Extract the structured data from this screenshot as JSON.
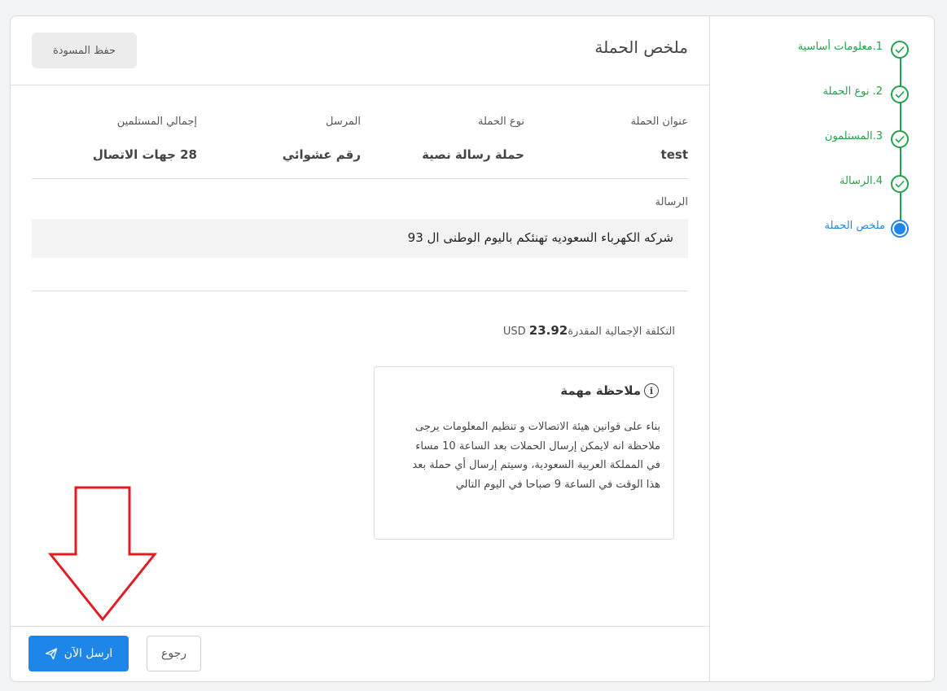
{
  "stepper": {
    "steps": [
      {
        "label": "1.معلومات أساسية",
        "state": "done"
      },
      {
        "label": "2. نوع الحملة",
        "state": "done"
      },
      {
        "label": "3.المستلمون",
        "state": "done"
      },
      {
        "label": "4.الرسالة",
        "state": "done"
      },
      {
        "label": "ملخص الحملة",
        "state": "active"
      }
    ]
  },
  "header": {
    "title": "ملخص الحملة",
    "draft_label": "حفظ المسودة"
  },
  "summary": {
    "campaign_title_label": "عنوان الحملة",
    "campaign_title_value": "test",
    "campaign_type_label": "نوع الحملة",
    "campaign_type_value": "حملة رسالة نصية",
    "sender_label": "المرسل",
    "sender_value": "رقم عشوائي",
    "recipients_label": "إجمالي المستلمين",
    "recipients_value": "28 جهات الاتصال"
  },
  "message": {
    "label": "الرسالة",
    "text": "شركه الكهرباء السعوديه تهنئكم باليوم الوطنى ال 93"
  },
  "cost": {
    "label": "التكلفة الإجمالية المقدرة",
    "amount": "23.92",
    "currency": "USD"
  },
  "note": {
    "title": "ملاحظة مهمة",
    "icon": "info-icon",
    "body": "بناء على قوانين هيئة الاتصالات و تنظيم المعلومات يرجى ملاحظة انه لايمكن إرسال الحملات بعد الساعة 10 مساء في المملكة العربية السعودية، وسيتم إرسال أي حملة بعد هذا الوقت في الساعة 9 صباحا في اليوم التالي"
  },
  "footer": {
    "send_label": "ارسل الآن",
    "back_label": "رجوع"
  },
  "colors": {
    "primary": "#1e86e8",
    "done": "#22a34a",
    "annotation_arrow": "#e31b23"
  }
}
